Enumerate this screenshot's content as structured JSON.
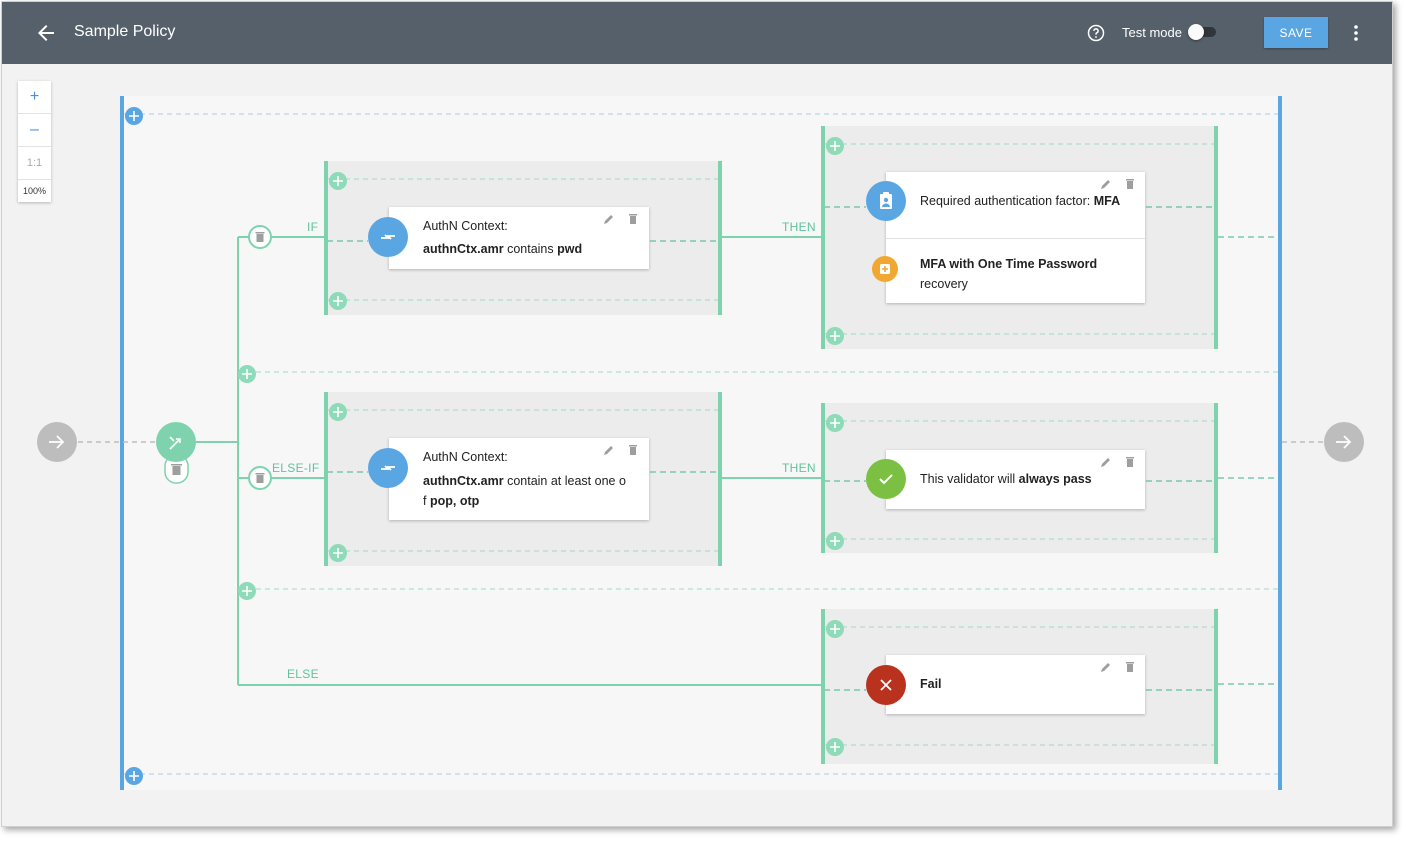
{
  "header": {
    "title": "Sample Policy",
    "test_mode_label": "Test mode",
    "save_label": "SAVE"
  },
  "zoom": {
    "zoom_in": "+",
    "zoom_out": "–",
    "reset": "1:1",
    "level": "100%"
  },
  "branches": {
    "if_label": "IF",
    "else_if_label": "ELSE-IF",
    "else_label": "ELSE",
    "then_label": "THEN"
  },
  "conditions": [
    {
      "title": "AuthN Context:",
      "attr": "authnCtx.amr",
      "op": "contains",
      "value": "pwd"
    },
    {
      "title": "AuthN Context:",
      "attr": "authnCtx.amr",
      "op_line1": "contain at least one o",
      "op_line2": "f",
      "value": "pop, otp"
    }
  ],
  "actions": {
    "required_factor_text": "Required authentication factor:",
    "required_factor_value": "MFA",
    "mfa_otp_title": "MFA with One Time Password",
    "mfa_otp_sub": "recovery",
    "validator_text": "This validator will",
    "validator_strong": "always pass",
    "fail_label": "Fail"
  },
  "colors": {
    "header": "#56606a",
    "accent_blue": "#5aa6e3",
    "branch_green": "#7ed3ae",
    "success": "#7cc043",
    "fail": "#b8321e",
    "warning": "#f0a830"
  }
}
